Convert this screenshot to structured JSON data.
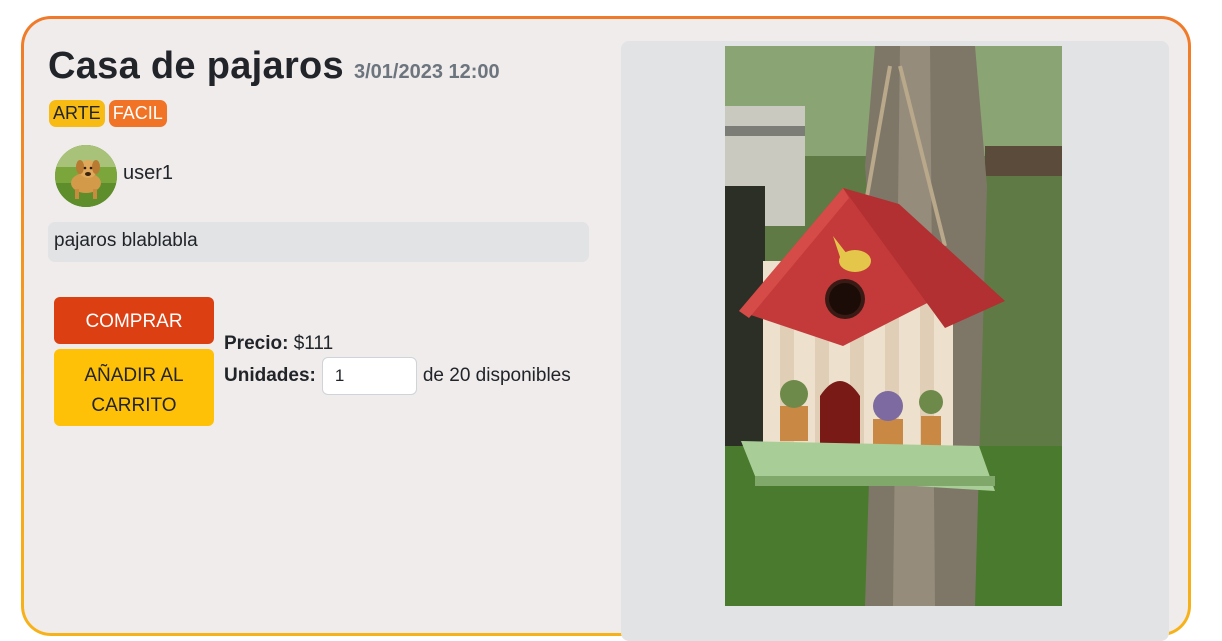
{
  "product": {
    "title": "Casa de pajaros",
    "date": "3/01/2023 12:00",
    "tags": [
      "ARTE",
      "FACIL"
    ],
    "user": "user1",
    "description": "pajaros blablabla"
  },
  "actions": {
    "buy_label": "COMPRAR",
    "cart_label": "AÑADIR AL CARRITO"
  },
  "pricing": {
    "price_label": "Precio:",
    "price_value": "$111",
    "units_label": "Unidades:",
    "units_value": "1",
    "available_text": "de 20 disponibles"
  },
  "colors": {
    "border_gradient_top": "#f07a2a",
    "border_gradient_bottom": "#f7b21a",
    "buy_button": "#dc3f12",
    "cart_button": "#ffc107",
    "tag_arte": "#f8bb14",
    "tag_facil": "#f07326"
  },
  "icons": {
    "avatar": "dog-avatar-image",
    "product_image": "birdhouse-photo"
  }
}
